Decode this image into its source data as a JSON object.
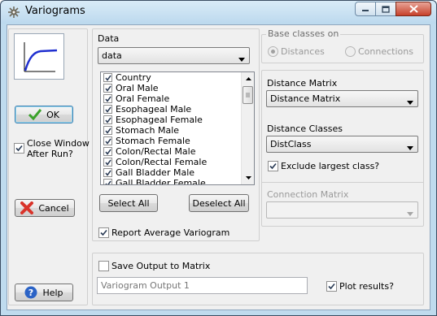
{
  "window": {
    "title": "Variograms"
  },
  "left": {
    "ok_label": "OK",
    "close_after_run_label": "Close Window\nAfter Run?",
    "close_after_run_checked": true,
    "cancel_label": "Cancel",
    "help_label": "Help"
  },
  "data": {
    "section_label": "Data",
    "selected": "data",
    "items": [
      {
        "label": "Country",
        "checked": true
      },
      {
        "label": "Oral Male",
        "checked": true
      },
      {
        "label": "Oral Female",
        "checked": true
      },
      {
        "label": "Esophageal Male",
        "checked": true
      },
      {
        "label": "Esophageal Female",
        "checked": true
      },
      {
        "label": "Stomach Male",
        "checked": true
      },
      {
        "label": "Stomach Female",
        "checked": true
      },
      {
        "label": "Colon/Rectal Male",
        "checked": true
      },
      {
        "label": "Colon/Rectal Female",
        "checked": true
      },
      {
        "label": "Gall Bladder Male",
        "checked": true
      },
      {
        "label": "Gall Bladder Female",
        "checked": true
      }
    ],
    "select_all_label": "Select All",
    "deselect_all_label": "Deselect All",
    "report_avg_label": "Report Average Variogram",
    "report_avg_checked": true
  },
  "base_classes": {
    "label": "Base classes on",
    "distances_label": "Distances",
    "connections_label": "Connections"
  },
  "distance": {
    "matrix_label": "Distance Matrix",
    "matrix_value": "Distance Matrix",
    "classes_label": "Distance Classes",
    "classes_value": "DistClass",
    "exclude_label": "Exclude largest class?",
    "exclude_checked": true
  },
  "connection": {
    "matrix_label": "Connection Matrix",
    "matrix_value": ""
  },
  "output": {
    "save_label": "Save Output to Matrix",
    "save_checked": false,
    "name_value": "Variogram Output 1",
    "plot_label": "Plot results?",
    "plot_checked": true
  }
}
